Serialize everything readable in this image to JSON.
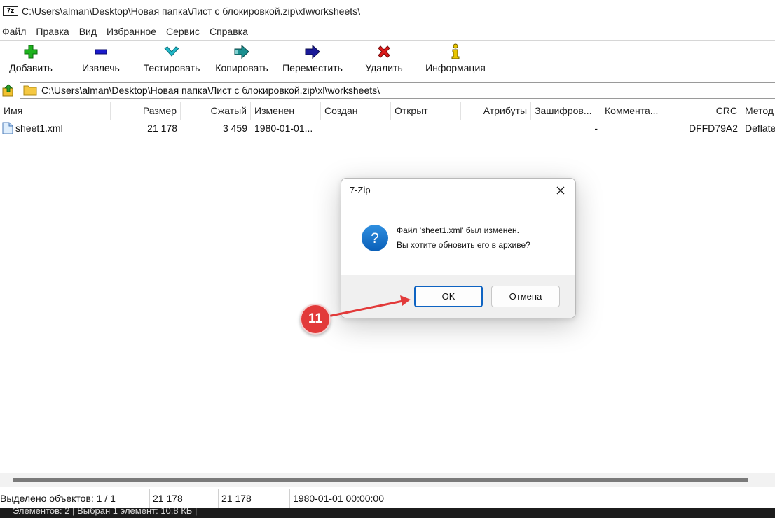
{
  "window": {
    "app_icon_text": "7z",
    "title": "C:\\Users\\alman\\Desktop\\Новая папка\\Лист с блокировкой.zip\\xl\\worksheets\\"
  },
  "menu": [
    "Файл",
    "Правка",
    "Вид",
    "Избранное",
    "Сервис",
    "Справка"
  ],
  "toolbar": [
    {
      "label": "Добавить",
      "icon": "plus-icon",
      "color": "#1db21d"
    },
    {
      "label": "Извлечь",
      "icon": "minus-icon",
      "color": "#1a1acc"
    },
    {
      "label": "Тестировать",
      "icon": "check-icon",
      "color": "#1fb7c7"
    },
    {
      "label": "Копировать",
      "icon": "copy-arrow-icon",
      "color": "#1a8f8f"
    },
    {
      "label": "Переместить",
      "icon": "move-arrow-icon",
      "color": "#1a1a99"
    },
    {
      "label": "Удалить",
      "icon": "delete-x-icon",
      "color": "#dd1a1a"
    },
    {
      "label": "Информация",
      "icon": "info-icon",
      "color": "#c9a400"
    }
  ],
  "address": {
    "path": "C:\\Users\\alman\\Desktop\\Новая папка\\Лист с блокировкой.zip\\xl\\worksheets\\"
  },
  "columns": [
    "Имя",
    "Размер",
    "Сжатый",
    "Изменен",
    "Создан",
    "Открыт",
    "Атрибуты",
    "Зашифров...",
    "Коммента...",
    "CRC",
    "Метод"
  ],
  "files": [
    {
      "name": "sheet1.xml",
      "size": "21 178",
      "packed": "3 459",
      "modified": "1980-01-01...",
      "created": "",
      "accessed": "",
      "attributes": "",
      "encrypted": "-",
      "comment": "",
      "crc": "DFFD79A2",
      "method": "Deflate"
    }
  ],
  "status": {
    "selected": "Выделено объектов: 1 / 1",
    "size": "21 178",
    "packed": "21 178",
    "date": "1980-01-01 00:00:00"
  },
  "taskbar": {
    "text": "Элементов: 2   |   Выбран 1 элемент: 10,8 КБ   |"
  },
  "dialog": {
    "title": "7-Zip",
    "line1": "Файл 'sheet1.xml' был изменен.",
    "line2": "Вы хотите обновить его в архиве?",
    "ok_label": "OK",
    "cancel_label": "Отмена",
    "icon": "question-icon",
    "accent": "#0e63c2"
  },
  "annotation": {
    "step": "11",
    "color": "#e23a3a"
  }
}
